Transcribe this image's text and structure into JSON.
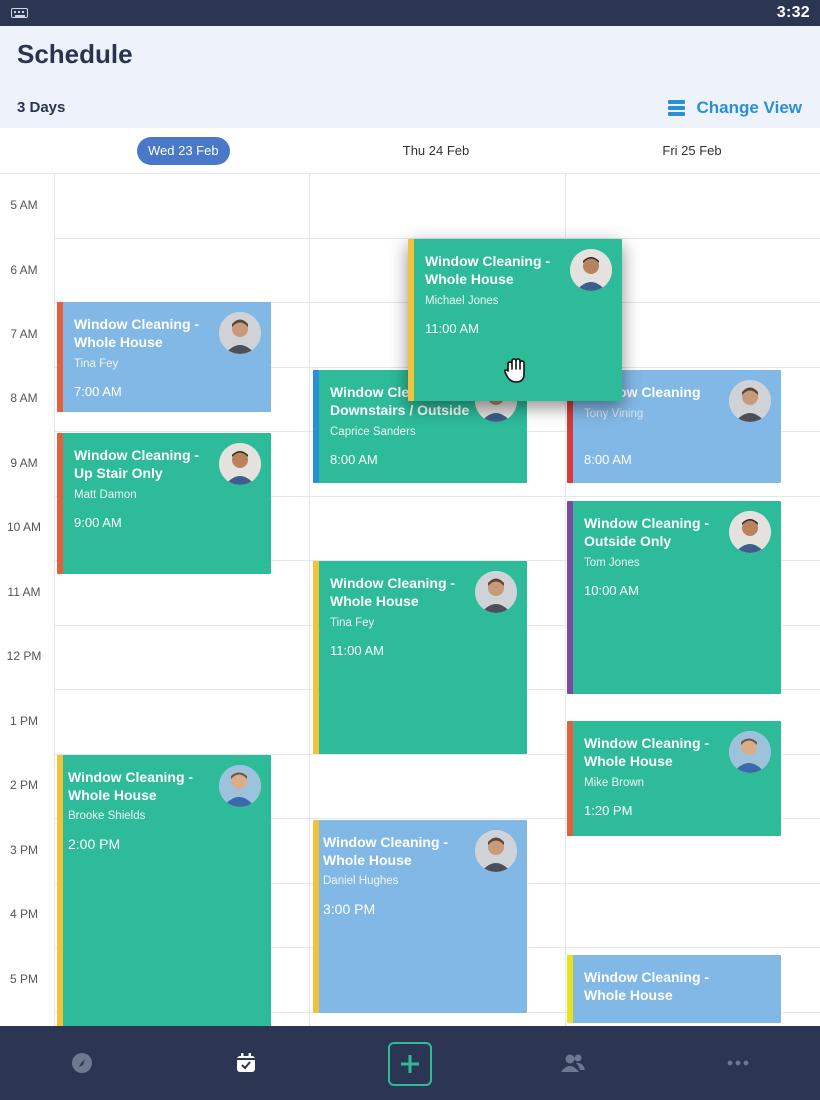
{
  "status_bar": {
    "time": "3:32"
  },
  "header": {
    "title": "Schedule",
    "view_mode": "3 Days",
    "change_view_label": "Change View"
  },
  "days": [
    {
      "label": "Wed 23 Feb",
      "selected": true
    },
    {
      "label": "Thu 24 Feb",
      "selected": false
    },
    {
      "label": "Fri 25 Feb",
      "selected": false
    }
  ],
  "hours": [
    "5 AM",
    "6 AM",
    "7 AM",
    "8 AM",
    "9 AM",
    "10 AM",
    "11 AM",
    "12 PM",
    "1 PM",
    "2 PM",
    "3 PM",
    "4 PM",
    "5 PM"
  ],
  "colors": {
    "green": "#2dbb99",
    "blue": "#82b8e6",
    "stripe_orange": "#e3603b",
    "stripe_yellow": "#f0c33a",
    "stripe_red": "#d63a3a",
    "stripe_purple": "#7a4aa0",
    "stripe_lime": "#e6e21e",
    "accent": "#2a8fd6",
    "nav_bg": "#2c3551"
  },
  "events": [
    {
      "title": "Window Cleaning - Whole House",
      "client": "Tina Fey",
      "time": "7:00 AM"
    },
    {
      "title": "Window Cleaning - Up Stair Only",
      "client": "Matt Damon",
      "time": "9:00 AM"
    },
    {
      "title": "Window Cleaning - Whole House",
      "client": "Brooke Shields",
      "time": "2:00 PM"
    },
    {
      "title": "Window Cleaning - Downstairs / Outside",
      "client": "Caprice Sanders",
      "time": "8:00 AM"
    },
    {
      "title": "Window Cleaning - Whole House",
      "client": "Tina Fey",
      "time": "11:00 AM"
    },
    {
      "title": "Window Cleaning - Whole House",
      "client": "Daniel Hughes",
      "time": "3:00 PM"
    },
    {
      "title": "Window Cleaning - Whole House",
      "client": "Michael Jones",
      "time": "11:00 AM"
    },
    {
      "title": "Window Cleaning",
      "client": "Tony Vining",
      "time": "8:00 AM"
    },
    {
      "title": "Window Cleaning - Outside Only",
      "client": "Tom Jones",
      "time": "10:00 AM"
    },
    {
      "title": "Window Cleaning - Whole House",
      "client": "Mike Brown",
      "time": "1:20 PM"
    },
    {
      "title": "Window Cleaning - Whole House",
      "client": "",
      "time": ""
    }
  ],
  "nav": {
    "items": [
      "dashboard-icon",
      "calendar-icon",
      "add-icon",
      "people-icon",
      "more-icon"
    ],
    "active": "calendar-icon"
  }
}
